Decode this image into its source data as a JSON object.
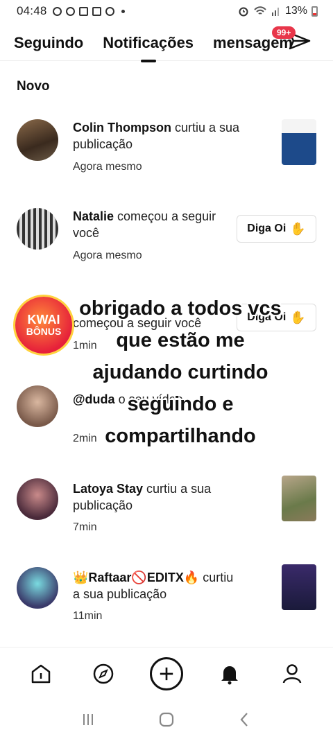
{
  "status_bar": {
    "time": "04:48",
    "battery": "13%"
  },
  "tabs": [
    {
      "label": "Seguindo"
    },
    {
      "label": "Notificações"
    },
    {
      "label": "mensagem"
    }
  ],
  "messages_badge": "99+",
  "section_title": "Novo",
  "notifications": [
    {
      "name": "Colin Thompson",
      "action": " curtiu a sua publicação",
      "time": "Agora mesmo"
    },
    {
      "name": "Natalie",
      "action": " começou a seguir você",
      "time": "Agora mesmo",
      "button": "Diga Oi"
    },
    {
      "name": "",
      "action": "começou a seguir você",
      "time": "1min",
      "button": "Diga Oi"
    },
    {
      "name": "@duda",
      "action": " o seu vídeo.",
      "time": "2min"
    },
    {
      "name": "Latoya Stay",
      "action": " curtiu a sua publicação",
      "time": "7min"
    },
    {
      "name": "👑Raftaar🚫EDITX🔥",
      "action": " curtiu a sua publicação",
      "time": "11min"
    }
  ],
  "overlay_caption": [
    "obrigado a todos vcs",
    "que estão me",
    "ajudando curtindo",
    "seguindo e",
    "compartilhando"
  ],
  "kwai_bonus": {
    "line1": "KWAI",
    "line2": "BÔNUS"
  },
  "icons": {
    "nav": [
      "home-icon",
      "compass-icon",
      "plus-icon",
      "bell-icon",
      "profile-icon"
    ],
    "system": [
      "recent-apps-icon",
      "home-circle-icon",
      "back-icon"
    ]
  },
  "colors": {
    "badge": "#e8364a",
    "kwai": "#e6203a"
  }
}
